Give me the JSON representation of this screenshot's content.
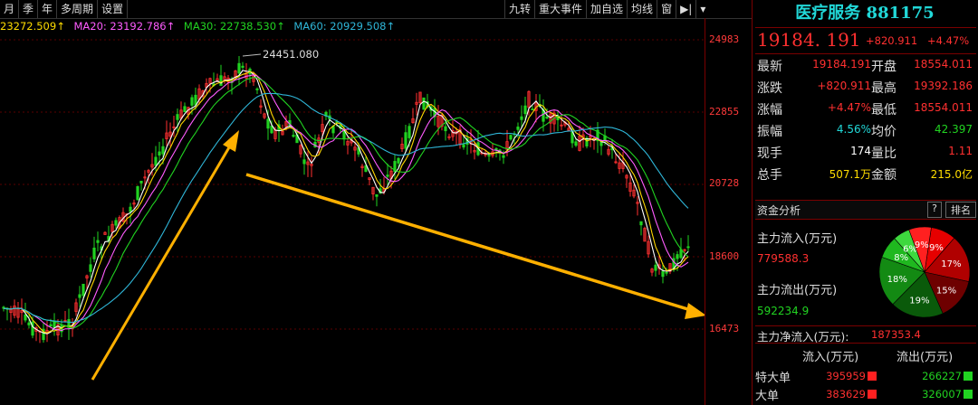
{
  "toolbar": {
    "left": [
      "月",
      "季",
      "年",
      "多周期",
      "设置"
    ],
    "right": [
      "九转",
      "重大事件",
      "加自选",
      "均线",
      "窗",
      "▶|",
      "▾"
    ]
  },
  "ma_legend": {
    "ma10": "23272.509↑",
    "ma20": "MA20: 23192.786↑",
    "ma30": "MA30: 22738.530↑",
    "ma60": "MA60: 20929.508↑"
  },
  "chart": {
    "high_marker": "24451.080",
    "y_ticks": [
      "24983",
      "22855",
      "20728",
      "18600",
      "16473"
    ]
  },
  "colors": {
    "up": "#ff3030",
    "down": "#21d321",
    "arrow": "#ffb000",
    "ma5": "#ffffff",
    "ma10": "#ffd700",
    "ma20": "#ff5cff",
    "ma30": "#21d321",
    "ma60": "#2fb6d8"
  },
  "panel": {
    "title": "医疗服务 881175",
    "price": "19184. 191",
    "change": "+820.911",
    "change_pct": "+4.47%",
    "quotes": [
      {
        "l1": "最新",
        "v1": "19184.191",
        "c1": "red",
        "l2": "开盘",
        "v2": "18554.011",
        "c2": "red"
      },
      {
        "l1": "涨跌",
        "v1": "+820.911",
        "c1": "red",
        "l2": "最高",
        "v2": "19392.186",
        "c2": "red"
      },
      {
        "l1": "涨幅",
        "v1": "+4.47%",
        "c1": "red",
        "l2": "最低",
        "v2": "18554.011",
        "c2": "red"
      },
      {
        "l1": "振幅",
        "v1": "4.56%",
        "c1": "cyan",
        "l2": "均价",
        "v2": "42.397",
        "c2": "green"
      },
      {
        "l1": "现手",
        "v1": "174",
        "c1": "white",
        "l2": "量比",
        "v2": "1.11",
        "c2": "red"
      },
      {
        "l1": "总手",
        "v1": "507.1万",
        "c1": "yellow",
        "l2": "金额",
        "v2": "215.0亿",
        "c2": "yellow"
      }
    ],
    "capital": {
      "header": "资金分析",
      "help": "?",
      "rank": "排名",
      "inflow_label": "主力流入(万元)",
      "inflow_value": "779588.3",
      "outflow_label": "主力流出(万元)",
      "outflow_value": "592234.9",
      "net_label": "主力净流入(万元):",
      "net_value": "187353.4",
      "pie": [
        {
          "label": "9%",
          "value": 9,
          "color": "#e60000"
        },
        {
          "label": "17%",
          "value": 17,
          "color": "#b00000"
        },
        {
          "label": "15%",
          "value": 15,
          "color": "#6e0000"
        },
        {
          "label": "19%",
          "value": 19,
          "color": "#0a5a0a"
        },
        {
          "label": "18%",
          "value": 18,
          "color": "#138a13"
        },
        {
          "label": "8%",
          "value": 8,
          "color": "#1fb81f"
        },
        {
          "label": "6%",
          "value": 6,
          "color": "#3ed83e"
        },
        {
          "label": "9%",
          "value": 8,
          "color": "#ff2020"
        }
      ]
    },
    "flow": {
      "in_header": "流入(万元)",
      "out_header": "流出(万元)",
      "rows": [
        {
          "name": "特大单",
          "in": "395959",
          "out": "266227"
        },
        {
          "name": "大单",
          "in": "383629",
          "out": "326007"
        }
      ]
    }
  }
}
